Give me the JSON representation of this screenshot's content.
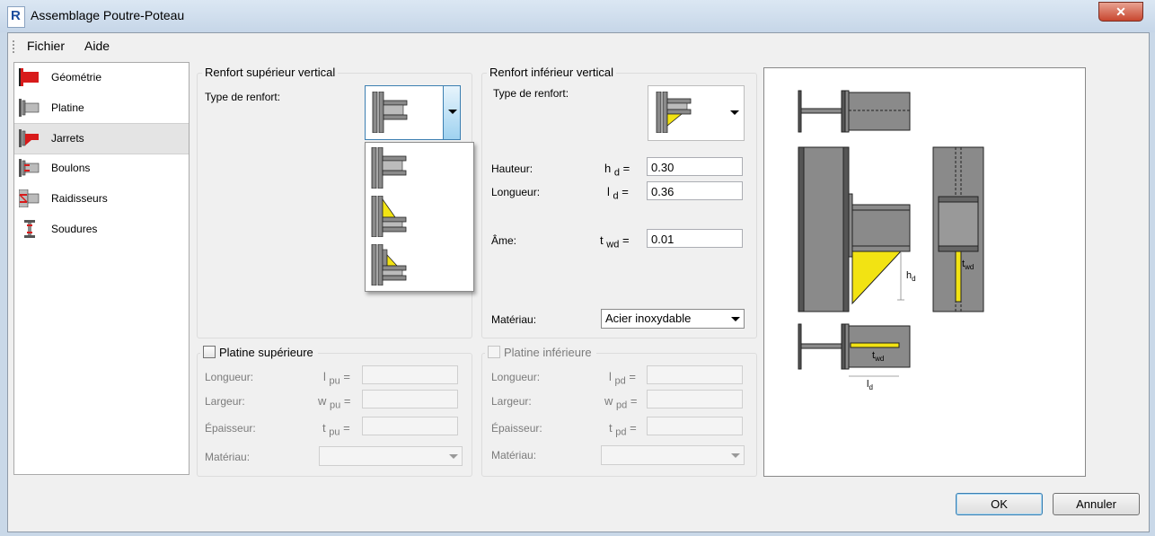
{
  "window": {
    "title": "Assemblage Poutre-Poteau",
    "close": "✕"
  },
  "app_icon_letter": "R",
  "menu": [
    "Fichier",
    "Aide"
  ],
  "sidebar": {
    "items": [
      {
        "label": "Géométrie",
        "icon": "geometry-icon"
      },
      {
        "label": "Platine",
        "icon": "plate-icon"
      },
      {
        "label": "Jarrets",
        "icon": "haunch-icon"
      },
      {
        "label": "Boulons",
        "icon": "bolts-icon"
      },
      {
        "label": "Raidisseurs",
        "icon": "stiffeners-icon"
      },
      {
        "label": "Soudures",
        "icon": "welds-icon"
      }
    ],
    "selected": "Jarrets"
  },
  "renfort_sup": {
    "title": "Renfort supérieur vertical",
    "type_label": "Type de renfort:"
  },
  "renfort_inf": {
    "title": "Renfort inférieur vertical",
    "type_label": "Type de renfort:",
    "hauteur": {
      "label": "Hauteur:",
      "sym": "h",
      "sub": "d",
      "eq": "=",
      "value": "0.30"
    },
    "longueur": {
      "label": "Longueur:",
      "sym": "l",
      "sub": "d",
      "eq": "=",
      "value": "0.36"
    },
    "ame": {
      "label": "Âme:",
      "sym": "t",
      "sub": "wd",
      "eq": "=",
      "value": "0.01"
    },
    "materiau": {
      "label": "Matériau:",
      "value": "Acier inoxydable"
    }
  },
  "platine_sup": {
    "title": "Platine supérieure",
    "longueur": {
      "label": "Longueur:",
      "sym": "l",
      "sub": "pu",
      "eq": "="
    },
    "largeur": {
      "label": "Largeur:",
      "sym": "w",
      "sub": "pu",
      "eq": "="
    },
    "epaisseur": {
      "label": "Épaisseur:",
      "sym": "t",
      "sub": "pu",
      "eq": "="
    },
    "materiau": {
      "label": "Matériau:"
    }
  },
  "platine_inf": {
    "title": "Platine inférieure",
    "longueur": {
      "label": "Longueur:",
      "sym": "l",
      "sub": "pd",
      "eq": "="
    },
    "largeur": {
      "label": "Largeur:",
      "sym": "w",
      "sub": "pd",
      "eq": "="
    },
    "epaisseur": {
      "label": "Épaisseur:",
      "sym": "t",
      "sub": "pd",
      "eq": "="
    },
    "materiau": {
      "label": "Matériau:"
    }
  },
  "preview_labels": {
    "h": "h",
    "h_sub": "d",
    "t": "t",
    "t_sub": "wd",
    "l": "l",
    "l_sub": "d"
  },
  "buttons": {
    "ok": "OK",
    "cancel": "Annuler"
  },
  "colors": {
    "steel": "#8a8a8a",
    "weld_yellow": "#f2e313",
    "accent_red": "#d81b1b"
  }
}
